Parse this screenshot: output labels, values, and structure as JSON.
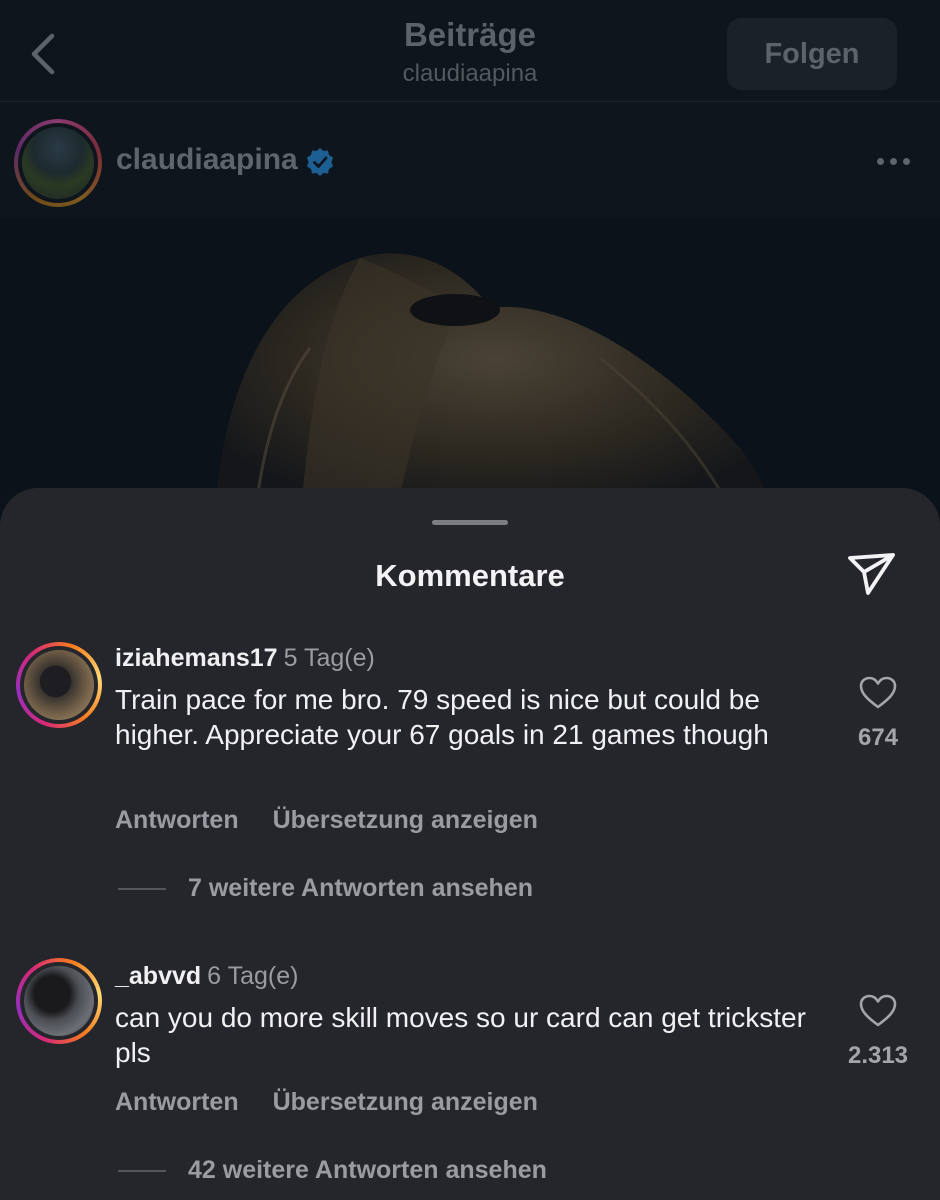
{
  "header": {
    "title": "Beiträge",
    "subtitle": "claudiaapina",
    "follow_label": "Folgen"
  },
  "post": {
    "author": "claudiaapina",
    "verified": true
  },
  "sheet": {
    "title": "Kommentare"
  },
  "comments": [
    {
      "username": "iziahemans17",
      "time": "5 Tag(e)",
      "text": "Train pace for me bro. 79 speed is nice but could be higher. Appreciate your 67 goals in 21 games though",
      "reply_label": "Antworten",
      "translate_label": "Übersetzung anzeigen",
      "likes": "674",
      "more_replies": "7 weitere Antworten ansehen"
    },
    {
      "username": "_abvvd",
      "time": "6 Tag(e)",
      "text": "can you do more skill moves so ur card can get trickster pls",
      "reply_label": "Antworten",
      "translate_label": "Übersetzung anzeigen",
      "likes": "2.313",
      "more_replies": "42 weitere Antworten ansehen"
    }
  ],
  "colors": {
    "background": "#0e151c",
    "sheet": "#25262b",
    "verified_badge": "#1d76c4",
    "story_ring": "#d62976"
  },
  "icons": [
    "chevron-left-icon",
    "verified-badge-icon",
    "more-icon",
    "send-icon",
    "heart-icon"
  ]
}
